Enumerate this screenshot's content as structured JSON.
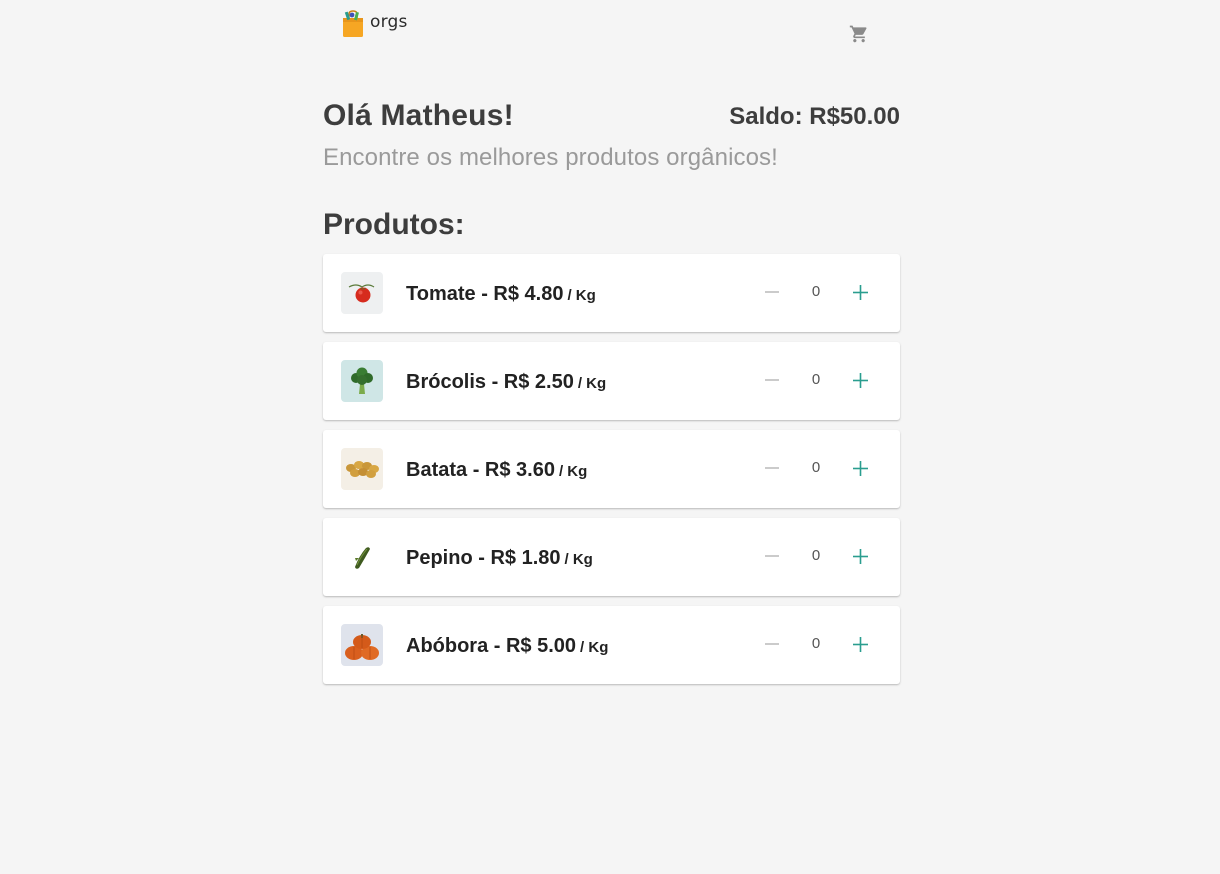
{
  "header": {
    "logo_text": "orgs",
    "logo_icon": "shopping-bag-icon",
    "cart_icon": "cart-icon"
  },
  "greeting": {
    "title": "Olá Matheus!",
    "balance": "Saldo: R$50.00",
    "subtitle": "Encontre os melhores produtos orgânicos!"
  },
  "products": {
    "section_title": "Produtos:",
    "unit": "/ Kg",
    "items": [
      {
        "name": "Tomate - R$ 4.80",
        "quantity": "0",
        "thumb": "tomato"
      },
      {
        "name": "Brócolis - R$ 2.50",
        "quantity": "0",
        "thumb": "broccoli"
      },
      {
        "name": "Batata - R$ 3.60",
        "quantity": "0",
        "thumb": "potato"
      },
      {
        "name": "Pepino - R$ 1.80",
        "quantity": "0",
        "thumb": "cucumber"
      },
      {
        "name": "Abóbora - R$ 5.00",
        "quantity": "0",
        "thumb": "pumpkin"
      }
    ]
  },
  "colors": {
    "accent": "#2a9d8f",
    "background": "#f5f5f5",
    "minus": "#b5b5b5",
    "logo_orange": "#f6a623"
  }
}
